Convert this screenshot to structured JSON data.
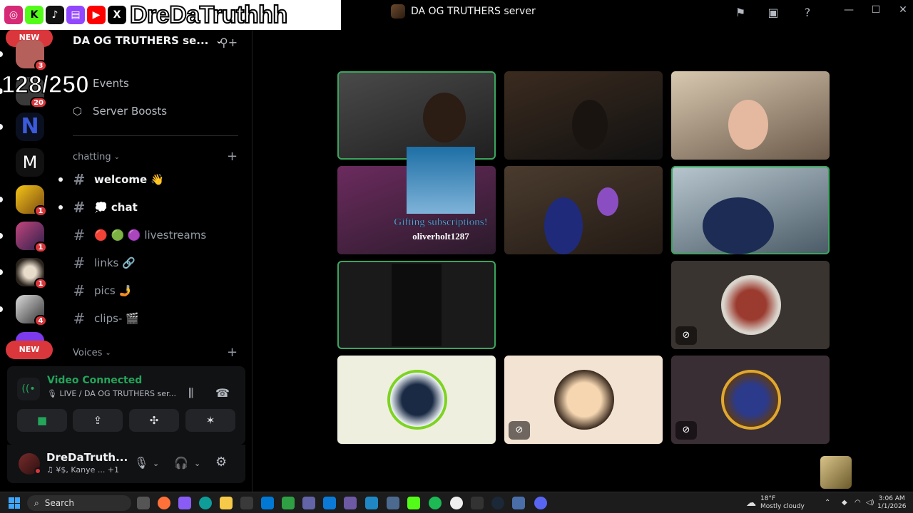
{
  "window": {
    "title": "DA OG TRUTHERS server"
  },
  "overlay": {
    "handle": "DreDaTruthhh",
    "counter": "128/250",
    "new_label": "NEW"
  },
  "server": {
    "name": "DA OG TRUTHERS se..."
  },
  "sidebar": {
    "events_label": "Events",
    "boosts_label": "Server Boosts",
    "category_chatting": "chatting",
    "category_voices": "Voices",
    "channels": [
      {
        "name": "welcome 👋",
        "unread": true
      },
      {
        "name": "💭 chat",
        "unread": true
      },
      {
        "name": "🔴 🟢 🟣 livestreams",
        "unread": false
      },
      {
        "name": "links 🔗",
        "unread": false
      },
      {
        "name": "pics 🤳",
        "unread": false
      },
      {
        "name": "clips- 🎬",
        "unread": false
      }
    ]
  },
  "rail": {
    "badges": [
      "3",
      "20",
      "1",
      "1",
      "1",
      "4"
    ]
  },
  "voice": {
    "status": "Video Connected",
    "channel": "🎙 LIVE / DA OG TRUTHERS ser..."
  },
  "user": {
    "name": "DreDaTruth...",
    "activity": "♫ ¥$, Kanye ...  +1"
  },
  "gift": {
    "title": "Gifting subscriptions!",
    "username": "oliverholt1287"
  },
  "taskbar": {
    "search_placeholder": "Search",
    "weather_temp": "18°F",
    "weather_desc": "Mostly cloudy",
    "time": "3:06 AM",
    "date": "1/1/2026"
  },
  "colors": {
    "accent_green": "#23a55a",
    "badge_red": "#da373c"
  }
}
